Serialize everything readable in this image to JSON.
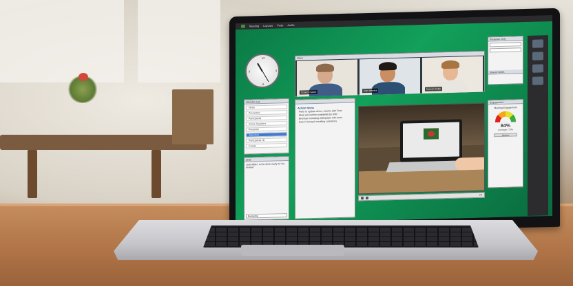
{
  "app": {
    "menu": [
      "Meeting",
      "Layouts",
      "Pods",
      "Audio"
    ]
  },
  "clock": {
    "label": "analog clock"
  },
  "attendees": {
    "title": "Attendee List",
    "rows": [
      "Hosts",
      "Presenters",
      "Participants",
      "Active Speakers",
      "Presenter",
      "Jane Doe",
      "Participants (4)",
      "Guests"
    ]
  },
  "chat": {
    "title": "Chat",
    "message": "Jane Miller: Is the deck ready for the review?",
    "input_placeholder": "Everyone"
  },
  "video": {
    "title": "Video",
    "participants": [
      {
        "name": "Connor Carter",
        "skin": "#d6a98d",
        "hair": "#8c6a4b",
        "shirt": "#3f5d86"
      },
      {
        "name": "Ivan Herrera",
        "skin": "#c98e64",
        "hair": "#1f1a16",
        "shirt": "#2c4f74"
      },
      {
        "name": "Doreen Kellar",
        "skin": "#e6b896",
        "hair": "#a8743f",
        "shirt": "#e9e5df"
      }
    ]
  },
  "notes": {
    "title": "Action Items",
    "items": [
      "Peter to update demo, volume with Tone",
      "Mark will confirm availability by 9/30",
      "Brennan reviewing whitepaper with team",
      "from IT Consult resulting customers"
    ]
  },
  "share": {
    "zoom_label": "Fit"
  },
  "presenter": {
    "title": "Presenter Only",
    "notes_label": "Shared Notes"
  },
  "engagement": {
    "title": "Engagement",
    "label": "Meeting Engagement",
    "value": 84,
    "value_text": "84%",
    "avg_text": "Average: 73%",
    "button": "Refresh"
  }
}
